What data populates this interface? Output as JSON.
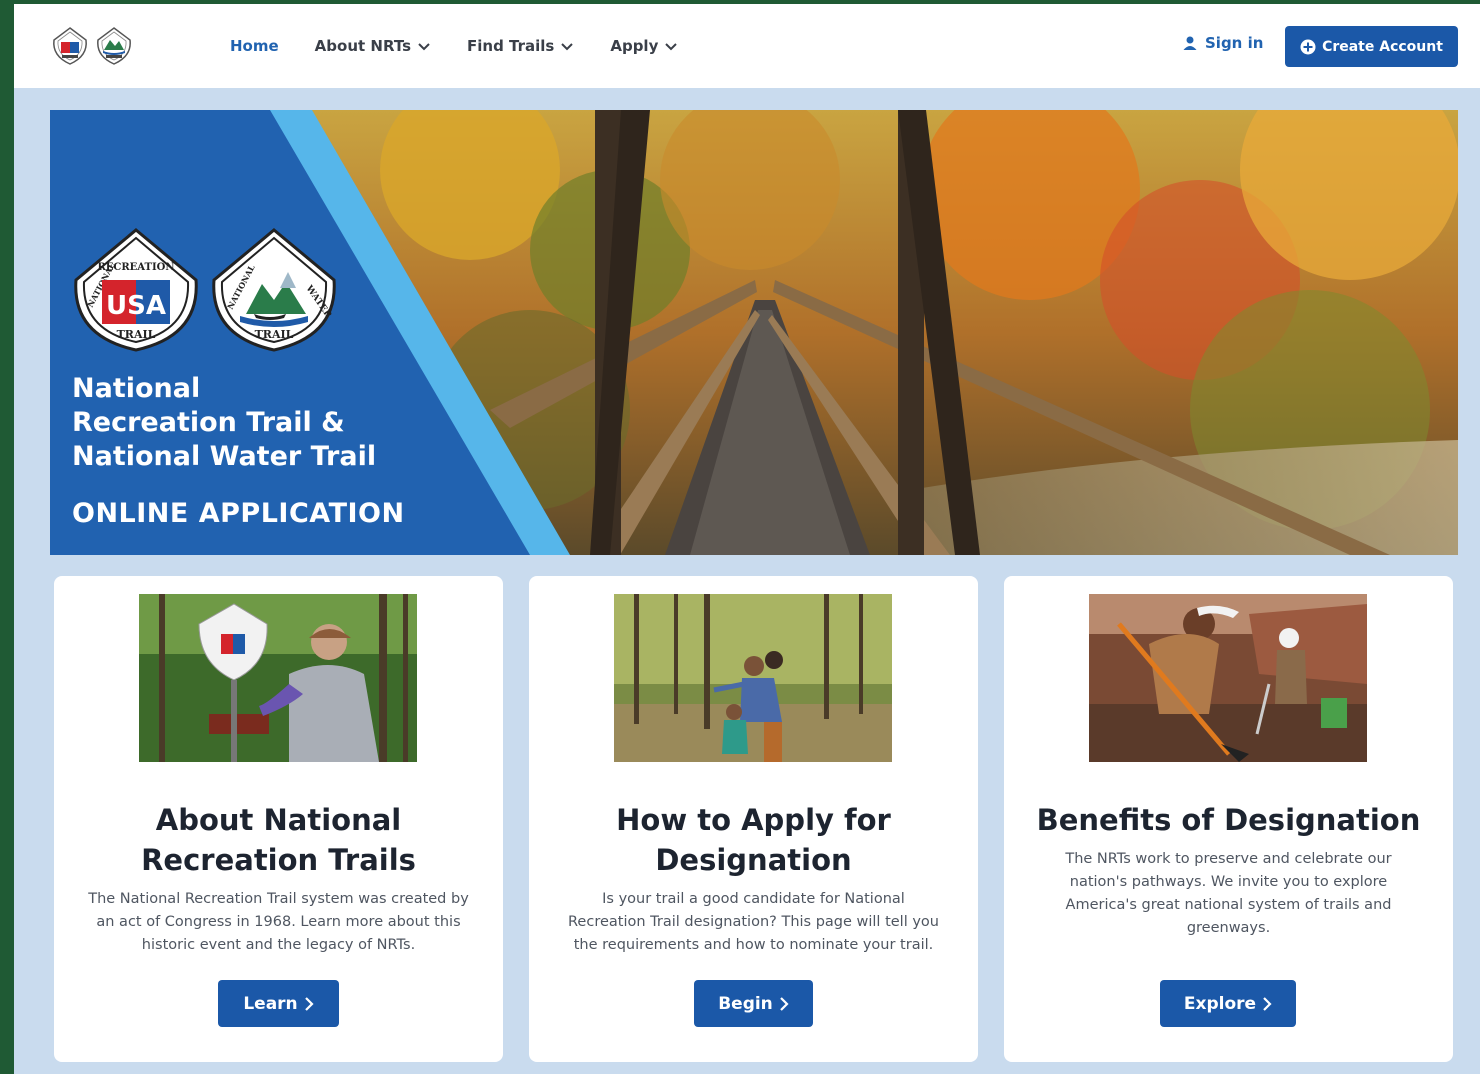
{
  "header": {
    "nav": {
      "home": "Home",
      "about": "About NRTs",
      "find": "Find Trails",
      "apply": "Apply"
    },
    "sign_in": "Sign in",
    "create_account": "Create Account"
  },
  "hero": {
    "shield_left": {
      "top": "RECREATION",
      "side": "NATIONAL",
      "mid": "USA",
      "bottom": "TRAIL"
    },
    "shield_right": {
      "top": "WATER",
      "side": "NATIONAL",
      "bottom": "TRAIL"
    },
    "title_line1": "National",
    "title_line2": "Recreation Trail &",
    "title_line3": "National Water Trail",
    "subtitle": "ONLINE APPLICATION"
  },
  "cards": [
    {
      "title_line1": "About National",
      "title_line2": "Recreation Trails",
      "text_line1": "The National Recreation Trail system was created by",
      "text_line2": "an act of Congress in 1968. Learn more about this",
      "text_line3": "historic event and the legacy of NRTs.",
      "button": "Learn"
    },
    {
      "title_line1": "How to Apply for",
      "title_line2": "Designation",
      "text_line1": "Is your trail a good candidate for National",
      "text_line2": "Recreation Trail designation? This page will tell you",
      "text_line3": "the requirements and how to nominate your trail.",
      "button": "Begin"
    },
    {
      "title_line1": "Benefits of Designation",
      "text_line1": "The NRTs work to preserve and celebrate our",
      "text_line2": "nation's pathways. We invite you to explore",
      "text_line3": "America's great national system of trails and",
      "text_line4": "greenways.",
      "button": "Explore"
    }
  ],
  "colors": {
    "primary": "#1b58a8",
    "hero_blue": "#2162b0",
    "hero_stripe": "#56b6ea",
    "page_bg": "#c9dbee",
    "outer_bg": "#1f5a34"
  }
}
